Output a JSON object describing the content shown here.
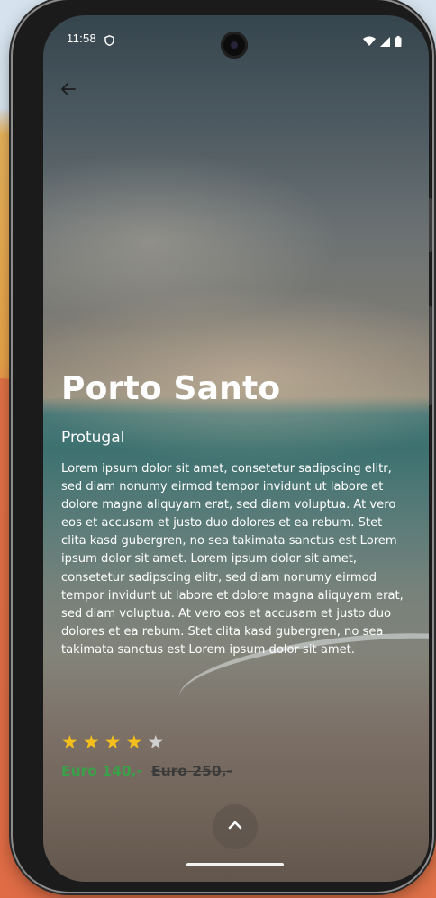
{
  "status_bar": {
    "time": "11:58",
    "icons": [
      "shield-icon",
      "wifi-icon",
      "signal-icon",
      "battery-icon"
    ]
  },
  "header": {
    "back_icon": "arrow-left-icon"
  },
  "destination": {
    "title": "Porto Santo",
    "country": "Protugal",
    "description": "Lorem ipsum dolor sit amet, consetetur sadipscing elitr, sed diam nonumy eirmod tempor invidunt ut labore et dolore magna aliquyam erat, sed diam voluptua. At vero eos et accusam et justo duo dolores et ea rebum. Stet clita kasd gubergren, no sea takimata sanctus est Lorem ipsum dolor sit amet. Lorem ipsum dolor sit amet, consetetur sadipscing elitr, sed diam nonumy eirmod tempor invidunt ut labore et dolore magna aliquyam erat, sed diam voluptua. At vero eos et accusam et justo duo dolores et ea rebum. Stet clita kasd gubergren, no sea takimata sanctus est Lorem ipsum dolor sit amet.",
    "rating": 4,
    "rating_max": 5,
    "price_new": "Euro 140,-",
    "price_old": "Euro 250,-"
  },
  "colors": {
    "star_filled": "#f4bf1c",
    "star_empty": "#cfcfcf",
    "price_new": "#3aa04a",
    "price_old": "#3b3b3b"
  },
  "actions": {
    "expand_icon": "chevron-up-icon"
  }
}
